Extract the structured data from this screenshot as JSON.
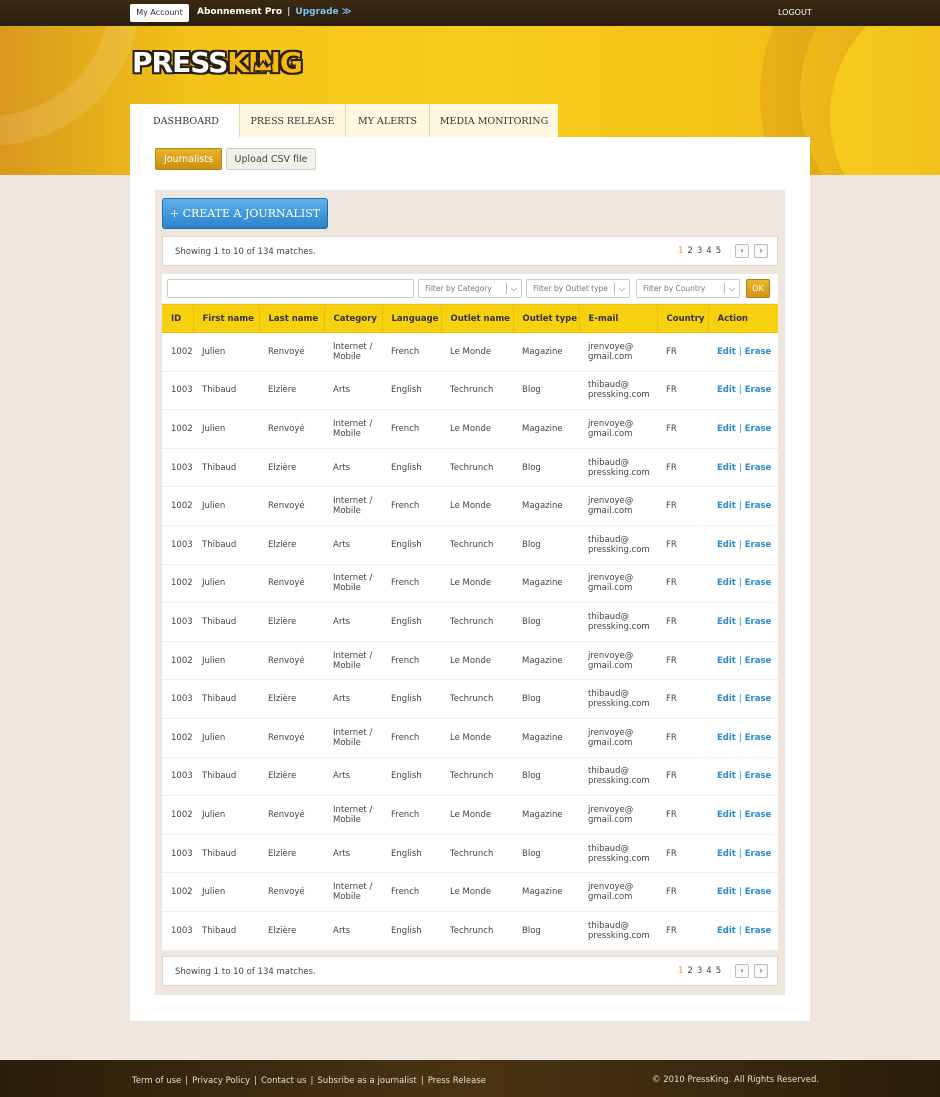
{
  "topbar": {
    "my_account": "My Account",
    "plan": "Abonnement Pro",
    "separator": "|",
    "upgrade": "Upgrade ≫",
    "logout": "LOGOUT"
  },
  "logo": {
    "press": "PRESS",
    "king": "KING"
  },
  "tabs": [
    {
      "label": "DASHBOARD"
    },
    {
      "label": "PRESS RELEASE"
    },
    {
      "label": "MY ALERTS"
    },
    {
      "label": "MEDIA MONITORING"
    }
  ],
  "subtabs": {
    "journalists": "Journalists",
    "upload_csv": "Upload CSV file"
  },
  "create_button": "+ CREATE A JOURNALIST",
  "pagination": {
    "showing": "Showing 1 to 10 of 134 matches.",
    "pages": [
      "1",
      "2",
      "3",
      "4",
      "5"
    ],
    "prev": "‹",
    "next": "›"
  },
  "filters": {
    "search_value": "",
    "category": "Filter by Category",
    "outlet_type": "Filter by Outlet type",
    "country": "Filter by Country",
    "ok": "OK"
  },
  "table": {
    "headers": [
      "ID",
      "First name",
      "Last name",
      "Category",
      "Language",
      "Outlet name",
      "Outlet type",
      "E-mail",
      "Country",
      "Action"
    ],
    "action_edit": "Edit",
    "action_sep": "|",
    "action_erase": "Erase",
    "rows": [
      [
        "1002",
        "Julien",
        "Renvoyé",
        "Internet / Mobile",
        "French",
        "Le Monde",
        "Magazine",
        "jrenvoye@ gmail.com",
        "FR"
      ],
      [
        "1003",
        "Thibaud",
        "Elzière",
        "Arts",
        "English",
        "Techrunch",
        "Blog",
        "thibaud@ pressking.com",
        "FR"
      ],
      [
        "1002",
        "Julien",
        "Renvoyé",
        "Internet / Mobile",
        "French",
        "Le Monde",
        "Magazine",
        "jrenvoye@ gmail.com",
        "FR"
      ],
      [
        "1003",
        "Thibaud",
        "Elzière",
        "Arts",
        "English",
        "Techrunch",
        "Blog",
        "thibaud@ pressking.com",
        "FR"
      ],
      [
        "1002",
        "Julien",
        "Renvoyé",
        "Internet / Mobile",
        "French",
        "Le Monde",
        "Magazine",
        "jrenvoye@ gmail.com",
        "FR"
      ],
      [
        "1003",
        "Thibaud",
        "Elzière",
        "Arts",
        "English",
        "Techrunch",
        "Blog",
        "thibaud@ pressking.com",
        "FR"
      ],
      [
        "1002",
        "Julien",
        "Renvoyé",
        "Internet / Mobile",
        "French",
        "Le Monde",
        "Magazine",
        "jrenvoye@ gmail.com",
        "FR"
      ],
      [
        "1003",
        "Thibaud",
        "Elzière",
        "Arts",
        "English",
        "Techrunch",
        "Blog",
        "thibaud@ pressking.com",
        "FR"
      ],
      [
        "1002",
        "Julien",
        "Renvoyé",
        "Internet / Mobile",
        "French",
        "Le Monde",
        "Magazine",
        "jrenvoye@ gmail.com",
        "FR"
      ],
      [
        "1003",
        "Thibaud",
        "Elzière",
        "Arts",
        "English",
        "Techrunch",
        "Blog",
        "thibaud@ pressking.com",
        "FR"
      ],
      [
        "1002",
        "Julien",
        "Renvoyé",
        "Internet / Mobile",
        "French",
        "Le Monde",
        "Magazine",
        "jrenvoye@ gmail.com",
        "FR"
      ],
      [
        "1003",
        "Thibaud",
        "Elzière",
        "Arts",
        "English",
        "Techrunch",
        "Blog",
        "thibaud@ pressking.com",
        "FR"
      ],
      [
        "1002",
        "Julien",
        "Renvoyé",
        "Internet / Mobile",
        "French",
        "Le Monde",
        "Magazine",
        "jrenvoye@ gmail.com",
        "FR"
      ],
      [
        "1003",
        "Thibaud",
        "Elzière",
        "Arts",
        "English",
        "Techrunch",
        "Blog",
        "thibaud@ pressking.com",
        "FR"
      ],
      [
        "1002",
        "Julien",
        "Renvoyé",
        "Internet / Mobile",
        "French",
        "Le Monde",
        "Magazine",
        "jrenvoye@ gmail.com",
        "FR"
      ],
      [
        "1003",
        "Thibaud",
        "Elzière",
        "Arts",
        "English",
        "Techrunch",
        "Blog",
        "thibaud@ pressking.com",
        "FR"
      ]
    ]
  },
  "footer": {
    "links": [
      "Term of use",
      "Privacy Policy",
      "Contact us",
      "Subsribe as a journalist",
      "Press Release"
    ],
    "separator": "|",
    "copyright": "© 2010 PressKing. All Rights Reserved."
  },
  "colors": {
    "brand_yellow": "#f8d10e",
    "link_blue": "#2a8bd5",
    "accent_orange": "#e8a21a"
  }
}
